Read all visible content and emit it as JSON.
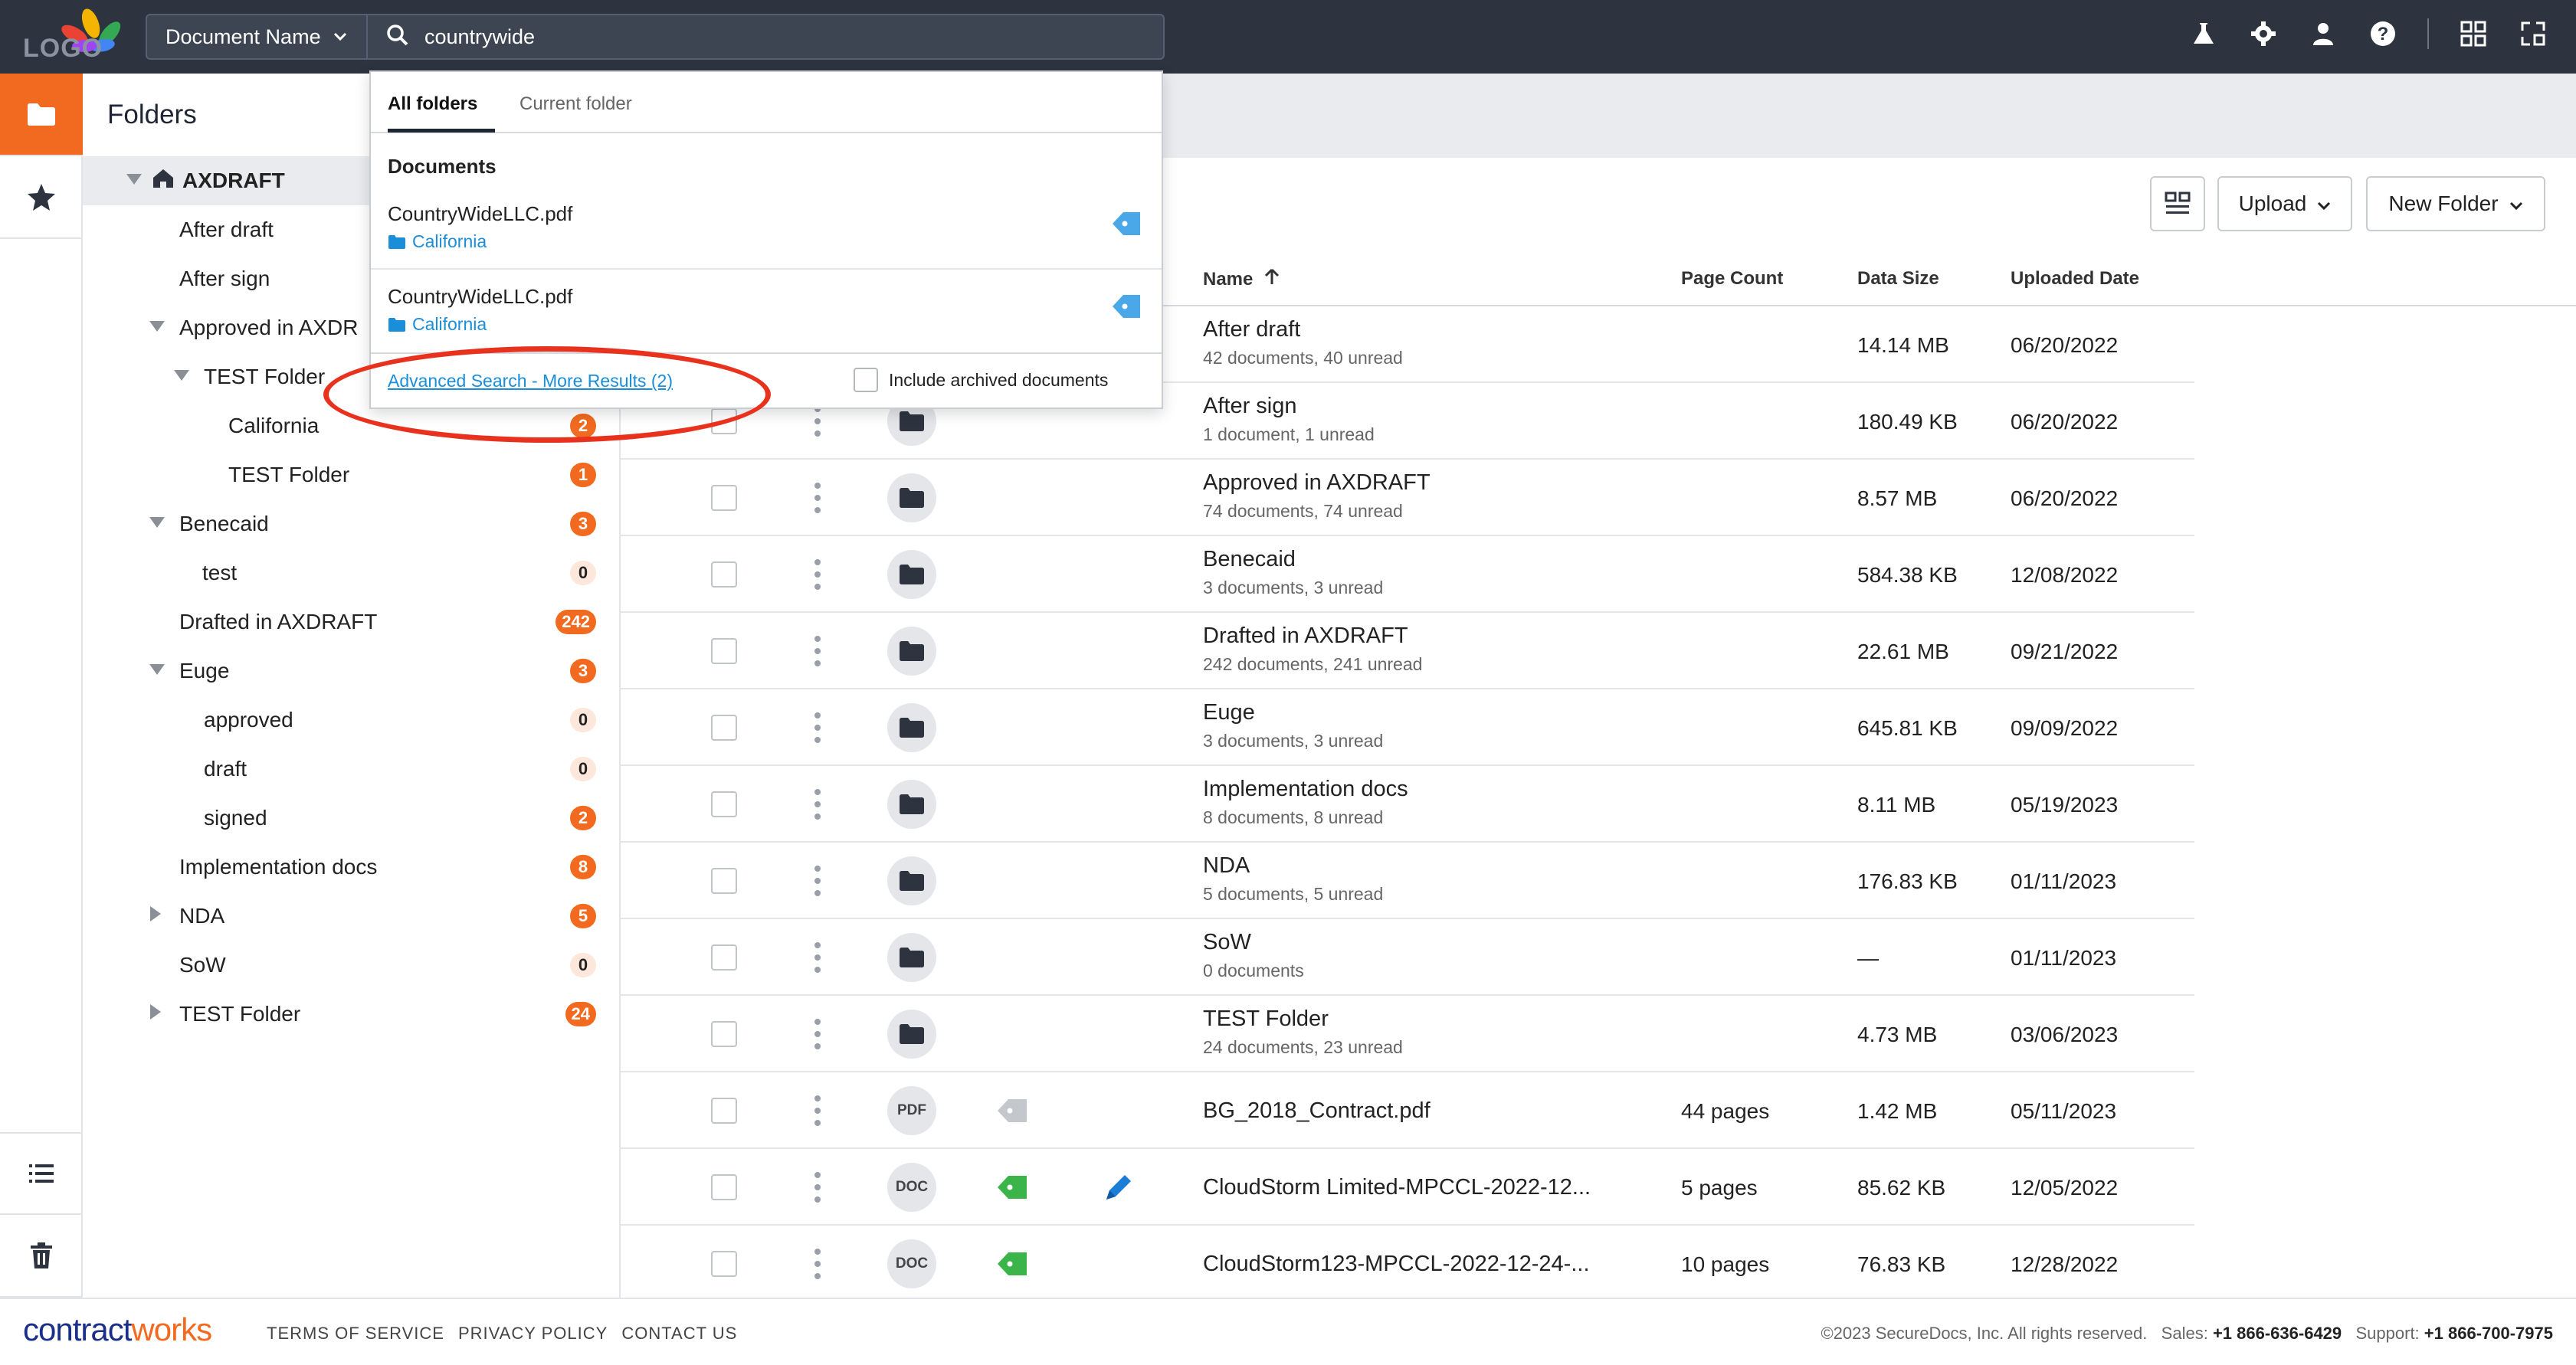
{
  "header": {
    "logo_text": "LOGO",
    "doc_select_label": "Document Name",
    "search_value": "countrywide"
  },
  "folders_panel": {
    "title": "Folders",
    "items": [
      {
        "label": "AXDRAFT",
        "badge": ""
      },
      {
        "label": "After draft",
        "badge": ""
      },
      {
        "label": "After sign",
        "badge": ""
      },
      {
        "label": "Approved in AXDR",
        "badge": ""
      },
      {
        "label": "TEST Folder",
        "badge": ""
      },
      {
        "label": "California",
        "badge": "2"
      },
      {
        "label": "TEST Folder",
        "badge": "1"
      },
      {
        "label": "Benecaid",
        "badge": "3"
      },
      {
        "label": "test",
        "badge": "0"
      },
      {
        "label": "Drafted in AXDRAFT",
        "badge": "242"
      },
      {
        "label": "Euge",
        "badge": "3"
      },
      {
        "label": "approved",
        "badge": "0"
      },
      {
        "label": "draft",
        "badge": "0"
      },
      {
        "label": "signed",
        "badge": "2"
      },
      {
        "label": "Implementation docs",
        "badge": "8"
      },
      {
        "label": "NDA",
        "badge": "5"
      },
      {
        "label": "SoW",
        "badge": "0"
      },
      {
        "label": "TEST Folder",
        "badge": "24"
      }
    ]
  },
  "toolbar": {
    "upload_label": "Upload",
    "new_folder_label": "New Folder"
  },
  "table": {
    "headers": {
      "name": "Name",
      "page_count": "Page Count",
      "data_size": "Data Size",
      "uploaded_date": "Uploaded Date"
    },
    "rows": [
      {
        "name": "After draft",
        "sub": "42 documents, 40 unread",
        "pages": "",
        "size": "14.14 MB",
        "date": "06/20/2022",
        "type": "folder"
      },
      {
        "name": "After sign",
        "sub": "1 document, 1 unread",
        "pages": "",
        "size": "180.49 KB",
        "date": "06/20/2022",
        "type": "folder"
      },
      {
        "name": "Approved in AXDRAFT",
        "sub": "74 documents, 74 unread",
        "pages": "",
        "size": "8.57 MB",
        "date": "06/20/2022",
        "type": "folder"
      },
      {
        "name": "Benecaid",
        "sub": "3 documents, 3 unread",
        "pages": "",
        "size": "584.38 KB",
        "date": "12/08/2022",
        "type": "folder"
      },
      {
        "name": "Drafted in AXDRAFT",
        "sub": "242 documents, 241 unread",
        "pages": "",
        "size": "22.61 MB",
        "date": "09/21/2022",
        "type": "folder"
      },
      {
        "name": "Euge",
        "sub": "3 documents, 3 unread",
        "pages": "",
        "size": "645.81 KB",
        "date": "09/09/2022",
        "type": "folder"
      },
      {
        "name": "Implementation docs",
        "sub": "8 documents, 8 unread",
        "pages": "",
        "size": "8.11 MB",
        "date": "05/19/2023",
        "type": "folder"
      },
      {
        "name": "NDA",
        "sub": "5 documents, 5 unread",
        "pages": "",
        "size": "176.83 KB",
        "date": "01/11/2023",
        "type": "folder"
      },
      {
        "name": "SoW",
        "sub": "0 documents",
        "pages": "",
        "size": "—",
        "date": "01/11/2023",
        "type": "folder"
      },
      {
        "name": "TEST Folder",
        "sub": "24 documents, 23 unread",
        "pages": "",
        "size": "4.73 MB",
        "date": "03/06/2023",
        "type": "folder"
      },
      {
        "name": "BG_2018_Contract.pdf",
        "sub": "",
        "pages": "44 pages",
        "size": "1.42 MB",
        "date": "05/11/2023",
        "type": "PDF"
      },
      {
        "name": "CloudStorm Limited-MPCCL-2022-12...",
        "sub": "",
        "pages": "5 pages",
        "size": "85.62 KB",
        "date": "12/05/2022",
        "type": "DOC"
      },
      {
        "name": "CloudStorm123-MPCCL-2022-12-24-...",
        "sub": "",
        "pages": "10 pages",
        "size": "76.83 KB",
        "date": "12/28/2022",
        "type": "DOC"
      }
    ]
  },
  "dropdown": {
    "tab_all": "All folders",
    "tab_current": "Current folder",
    "section": "Documents",
    "results": [
      {
        "name": "CountryWideLLC.pdf",
        "location": "California"
      },
      {
        "name": "CountryWideLLC.pdf",
        "location": "California"
      }
    ],
    "advanced_link": "Advanced Search - More Results (2)",
    "archived_label": "Include archived documents"
  },
  "footer": {
    "brand_a": "contract",
    "brand_b": "works",
    "terms": "TERMS OF SERVICE",
    "privacy": "PRIVACY POLICY",
    "contact": "CONTACT US",
    "copyright": "©2023 SecureDocs, Inc. All rights reserved.",
    "sales_label": "Sales:",
    "sales_phone": "+1 866-636-6429",
    "support_label": "Support:",
    "support_phone": "+1 866-700-7975"
  },
  "colors": {
    "accent": "#f26a1f",
    "topbar": "#2d3440",
    "link": "#1a8ed8",
    "annotation": "#e8321e"
  }
}
